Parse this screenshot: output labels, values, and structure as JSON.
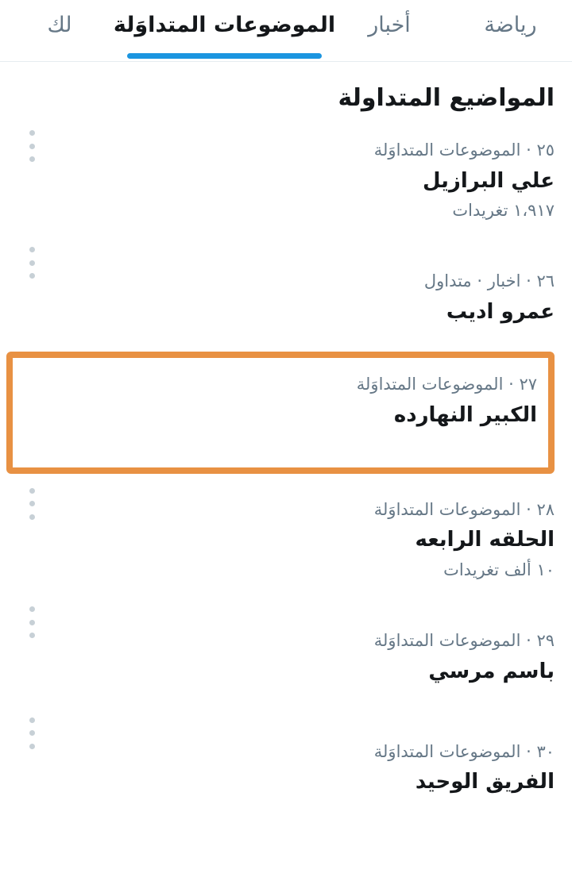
{
  "tabs": [
    {
      "id": "for-you",
      "label": "لك",
      "active": false
    },
    {
      "id": "trending",
      "label": "الموضوعات المتداوَلة",
      "active": true
    },
    {
      "id": "news",
      "label": "أخبار",
      "active": false
    },
    {
      "id": "sports",
      "label": "رياضة",
      "active": false
    }
  ],
  "section": {
    "heading": "المواضيع المتداولة"
  },
  "trends": [
    {
      "rank": "٢٥",
      "meta": "٢٥ · الموضوعات المتداوَلة",
      "name": "علي البرازيل",
      "count": "١،٩١٧ تغريدات",
      "highlighted": false
    },
    {
      "rank": "٢٦",
      "meta": "٢٦ · اخبار · متداول",
      "name": "عمرو اديب",
      "count": "",
      "highlighted": false
    },
    {
      "rank": "٢٧",
      "meta": "٢٧ · الموضوعات المتداوَلة",
      "name": "الكبير النهارده",
      "count": "",
      "highlighted": true
    },
    {
      "rank": "٢٨",
      "meta": "٢٨ · الموضوعات المتداوَلة",
      "name": "الحلقه الرابعه",
      "count": "١٠ ألف تغريدات",
      "highlighted": false
    },
    {
      "rank": "٢٩",
      "meta": "٢٩ · الموضوعات المتداوَلة",
      "name": "باسم مرسي",
      "count": "",
      "highlighted": false
    },
    {
      "rank": "٣٠",
      "meta": "٣٠ · الموضوعات المتداوَلة",
      "name": "الفريق الوحيد",
      "count": "",
      "highlighted": false
    }
  ],
  "icons": {
    "overflow": "more-vertical-icon"
  },
  "colors": {
    "accent": "#1b95e0",
    "highlight": "#e89143",
    "meta_text": "#657786",
    "primary_text": "#14171a",
    "divider": "#e6ecf0"
  }
}
